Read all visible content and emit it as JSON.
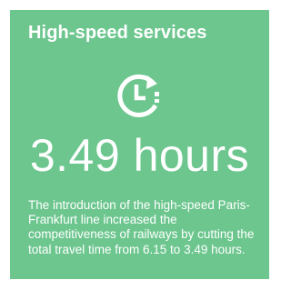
{
  "card": {
    "title": "High-speed services",
    "icon": "clock-refresh-icon",
    "stat": "3.49 hours",
    "description": "The introduction of the high-speed Paris-Frankfurt line increased the competitiveness of railways by cutting the total travel time from 6.15 to 3.49 hours.",
    "colors": {
      "background": "#6cc68e",
      "text": "#ffffff"
    }
  }
}
